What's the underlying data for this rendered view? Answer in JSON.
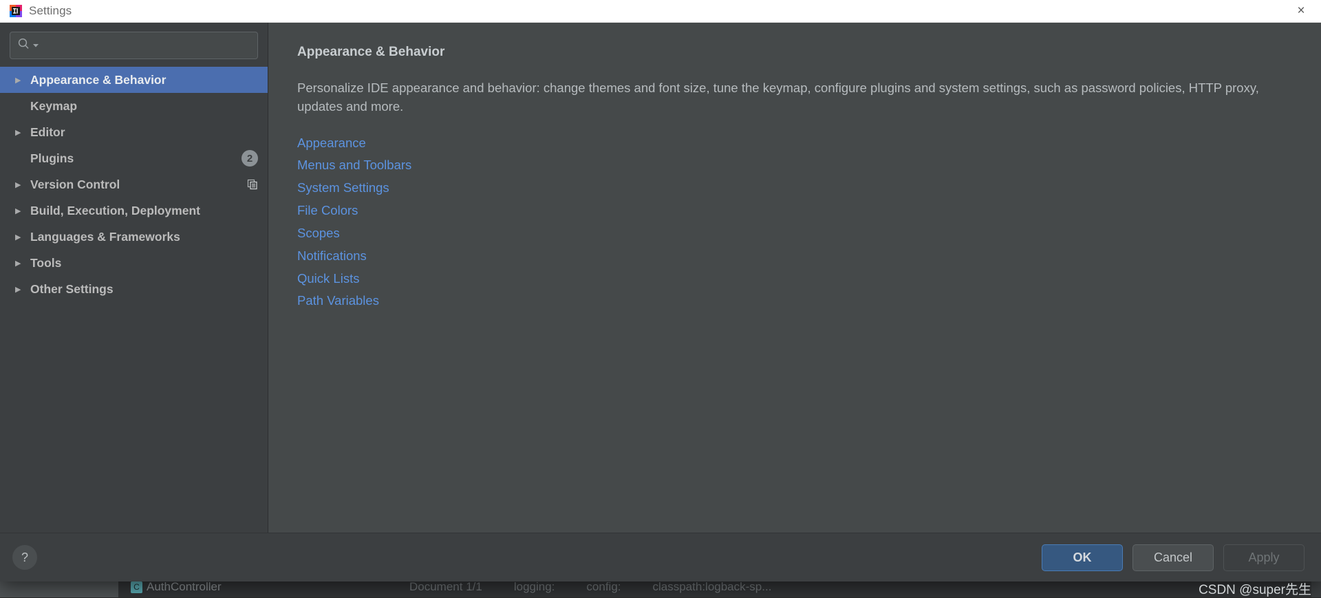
{
  "window": {
    "title": "Settings",
    "app_icon": "intellij-idea-logo",
    "close_label": "×"
  },
  "search": {
    "value": "",
    "placeholder": "",
    "icon": "search-icon",
    "dropdown_icon": "chevron-down-icon"
  },
  "sidebar": {
    "items": [
      {
        "label": "Appearance & Behavior",
        "expandable": true,
        "selected": true,
        "badge": "",
        "trailing_icon": ""
      },
      {
        "label": "Keymap",
        "expandable": false,
        "selected": false,
        "badge": "",
        "trailing_icon": ""
      },
      {
        "label": "Editor",
        "expandable": true,
        "selected": false,
        "badge": "",
        "trailing_icon": ""
      },
      {
        "label": "Plugins",
        "expandable": false,
        "selected": false,
        "badge": "2",
        "trailing_icon": ""
      },
      {
        "label": "Version Control",
        "expandable": true,
        "selected": false,
        "badge": "",
        "trailing_icon": "copy-icon"
      },
      {
        "label": "Build, Execution, Deployment",
        "expandable": true,
        "selected": false,
        "badge": "",
        "trailing_icon": ""
      },
      {
        "label": "Languages & Frameworks",
        "expandable": true,
        "selected": false,
        "badge": "",
        "trailing_icon": ""
      },
      {
        "label": "Tools",
        "expandable": true,
        "selected": false,
        "badge": "",
        "trailing_icon": ""
      },
      {
        "label": "Other Settings",
        "expandable": true,
        "selected": false,
        "badge": "",
        "trailing_icon": ""
      }
    ]
  },
  "content": {
    "title": "Appearance & Behavior",
    "description": "Personalize IDE appearance and behavior: change themes and font size, tune the keymap, configure plugins and system settings, such as password policies, HTTP proxy, updates and more.",
    "links": [
      "Appearance",
      "Menus and Toolbars",
      "System Settings",
      "File Colors",
      "Scopes",
      "Notifications",
      "Quick Lists",
      "Path Variables"
    ]
  },
  "footer": {
    "help_label": "?",
    "ok_label": "OK",
    "cancel_label": "Cancel",
    "apply_label": "Apply",
    "apply_disabled": true,
    "watermark": "CSDN @super先生"
  },
  "background": {
    "tab_label": "AuthController",
    "tab_badge": "C",
    "status_items": [
      "Document 1/1",
      "logging:",
      "config:",
      "classpath:logback-sp..."
    ]
  },
  "colors": {
    "accent": "#4b6eaf",
    "link": "#5c93e0",
    "primary_button": "#365880",
    "sidebar_bg": "#3c3f41",
    "content_bg": "#45494a",
    "titlebar_bg": "#ffffff"
  }
}
